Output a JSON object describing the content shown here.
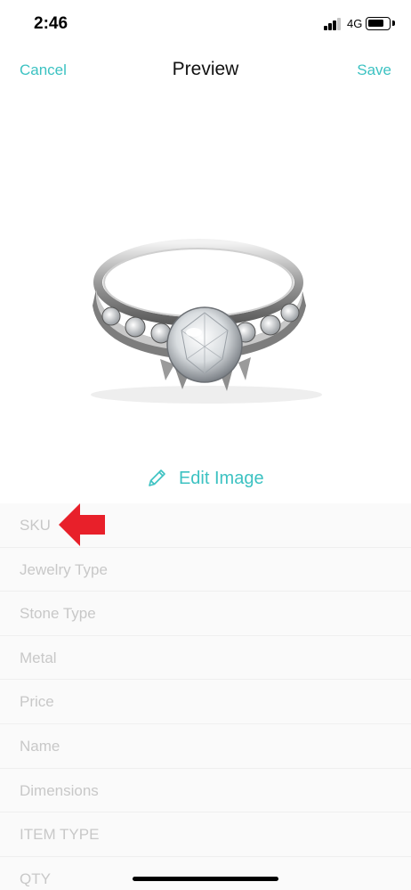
{
  "status_bar": {
    "time": "2:46",
    "network": "4G",
    "battery_level": 0.65,
    "signal_bars": 3
  },
  "nav": {
    "cancel_label": "Cancel",
    "title": "Preview",
    "save_label": "Save"
  },
  "preview": {
    "image_subject": "diamond-engagement-ring",
    "edit_label": "Edit Image"
  },
  "form": {
    "fields": [
      {
        "key": "sku",
        "placeholder": "SKU",
        "value": ""
      },
      {
        "key": "jewelry_type",
        "placeholder": "Jewelry Type",
        "value": ""
      },
      {
        "key": "stone_type",
        "placeholder": "Stone Type",
        "value": ""
      },
      {
        "key": "metal",
        "placeholder": "Metal",
        "value": ""
      },
      {
        "key": "price",
        "placeholder": "Price",
        "value": ""
      },
      {
        "key": "name",
        "placeholder": "Name",
        "value": ""
      },
      {
        "key": "dimensions",
        "placeholder": "Dimensions",
        "value": ""
      },
      {
        "key": "item_type",
        "placeholder": "ITEM TYPE",
        "value": ""
      },
      {
        "key": "qty",
        "placeholder": "QTY",
        "value": ""
      }
    ]
  },
  "annotation": {
    "icon": "red-arrow-icon",
    "color": "#e8202a"
  },
  "colors": {
    "accent": "#3cc2c2",
    "form_background": "#fafafa",
    "placeholder": "#c8c8c8"
  }
}
